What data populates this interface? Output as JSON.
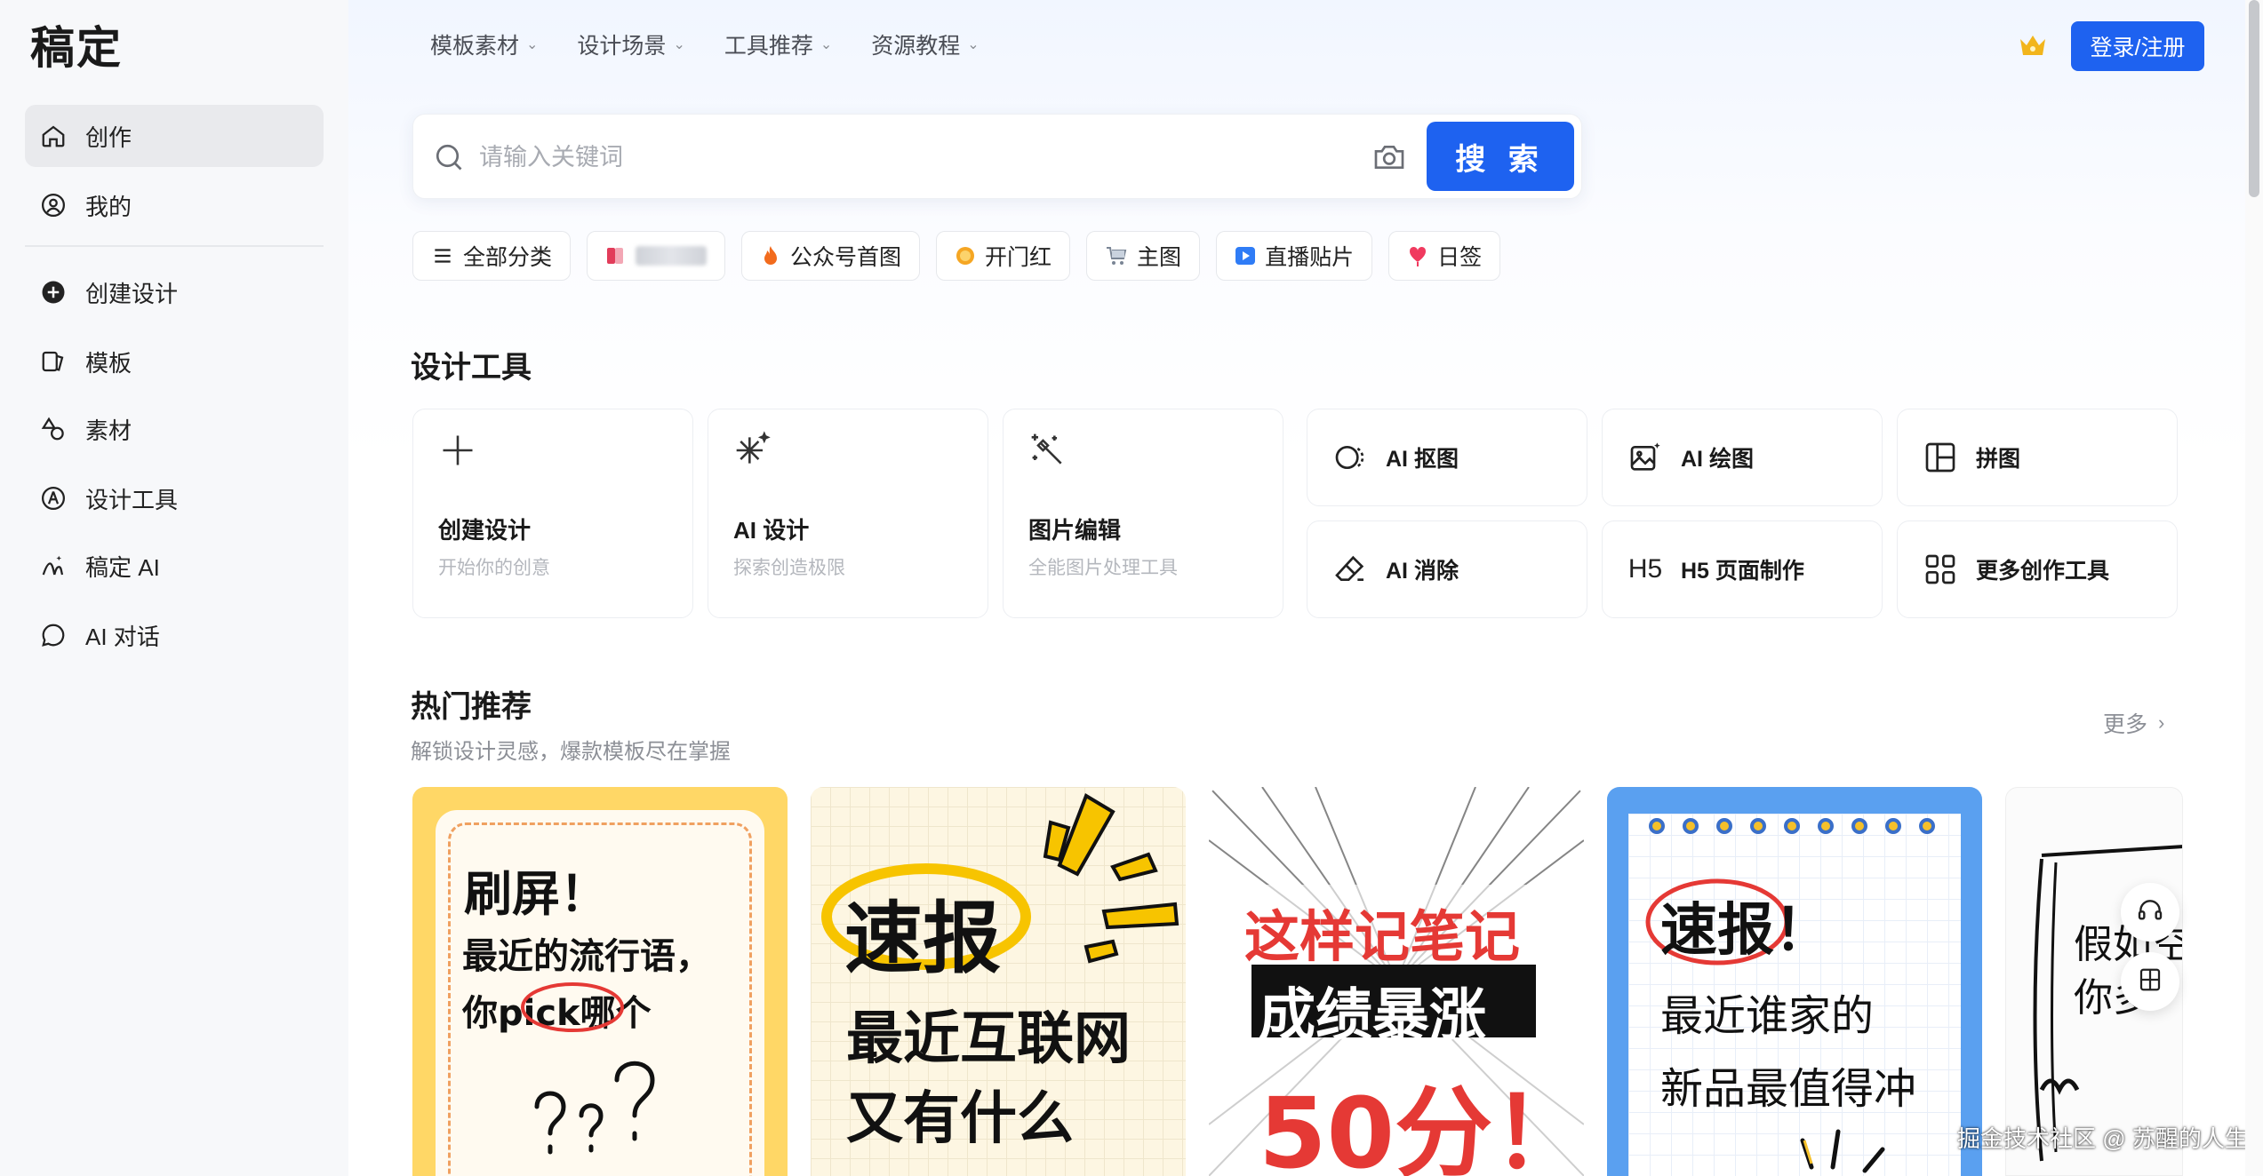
{
  "app": {
    "logo": "稿定"
  },
  "sidebar": {
    "items": [
      {
        "label": "创作",
        "icon": "home-icon",
        "active": true
      },
      {
        "label": "我的",
        "icon": "user-icon"
      },
      {
        "label": "创建设计",
        "icon": "plus-circle-icon"
      },
      {
        "label": "模板",
        "icon": "template-icon"
      },
      {
        "label": "素材",
        "icon": "shapes-icon"
      },
      {
        "label": "设计工具",
        "icon": "compass-icon"
      },
      {
        "label": "稿定 AI",
        "icon": "ai-icon"
      },
      {
        "label": "AI 对话",
        "icon": "chat-icon"
      }
    ]
  },
  "topnav": {
    "items": [
      "模板素材",
      "设计场景",
      "工具推荐",
      "资源教程"
    ],
    "login_label": "登录/注册",
    "crown_icon": "crown-icon"
  },
  "search": {
    "placeholder": "请输入关键词",
    "button_label": "搜 索",
    "camera_icon": "camera-icon"
  },
  "chips": [
    {
      "label": "全部分类",
      "icon": "menu-icon"
    },
    {
      "label": "",
      "icon": "blurred-icon"
    },
    {
      "label": "公众号首图",
      "icon": "fire-icon"
    },
    {
      "label": "开门红",
      "icon": "coin-icon"
    },
    {
      "label": "主图",
      "icon": "cart-icon"
    },
    {
      "label": "直播贴片",
      "icon": "play-icon"
    },
    {
      "label": "日签",
      "icon": "heart-icon"
    }
  ],
  "design_tools": {
    "title": "设计工具",
    "big": [
      {
        "title": "创建设计",
        "subtitle": "开始你的创意",
        "icon": "plus-icon"
      },
      {
        "title": "AI 设计",
        "subtitle": "探索创造极限",
        "icon": "sparkle-icon"
      },
      {
        "title": "图片编辑",
        "subtitle": "全能图片处理工具",
        "icon": "magic-wand-icon"
      }
    ],
    "small": [
      {
        "label": "AI 抠图",
        "icon": "cutout-icon"
      },
      {
        "label": "AI 绘图",
        "icon": "image-ai-icon"
      },
      {
        "label": "拼图",
        "icon": "collage-icon"
      },
      {
        "label": "AI 消除",
        "icon": "eraser-icon"
      },
      {
        "label": "H5 页面制作",
        "icon": "h5-icon",
        "icon_text": "H5"
      },
      {
        "label": "更多创作工具",
        "icon": "grid-icon"
      }
    ]
  },
  "hot": {
    "title": "热门推荐",
    "subtitle": "解锁设计灵感，爆款模板尽在掌握",
    "more_label": "更多",
    "cards": [
      {
        "lines": [
          "刷屏！",
          "最近的流行语，",
          "你pick哪个"
        ]
      },
      {
        "lines": [
          "速报",
          "最近互联网",
          "又有什么"
        ]
      },
      {
        "lines": [
          "这样记笔记",
          "成绩暴涨",
          "50分！"
        ]
      },
      {
        "lines": [
          "速报！",
          "最近谁家的",
          "新品最值得冲"
        ]
      },
      {
        "lines": [
          "假如空",
          "你多"
        ]
      }
    ]
  },
  "floating": {
    "support_icon": "headset-icon",
    "feedback_icon": "form-icon"
  },
  "watermark": "掘金技术社区 @ 苏醒的人生",
  "colors": {
    "primary": "#1e62f0",
    "sidebar_bg": "#f7f8fa",
    "active_bg": "#e9eaed"
  }
}
